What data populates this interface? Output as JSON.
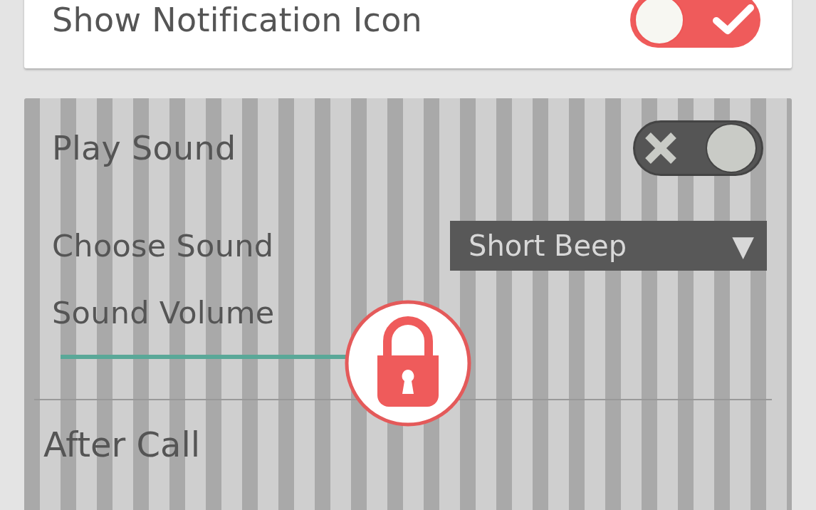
{
  "notification_card": {
    "label": "Show Notification Icon",
    "on": true
  },
  "sound_section": {
    "locked": true,
    "play_sound": {
      "label": "Play Sound",
      "on": false
    },
    "choose_sound": {
      "label": "Choose Sound",
      "value": "Short Beep",
      "caret": "▼"
    },
    "sound_volume": {
      "label": "Sound Volume",
      "level": 0.41
    }
  },
  "after_call": {
    "heading": "After Call"
  }
}
